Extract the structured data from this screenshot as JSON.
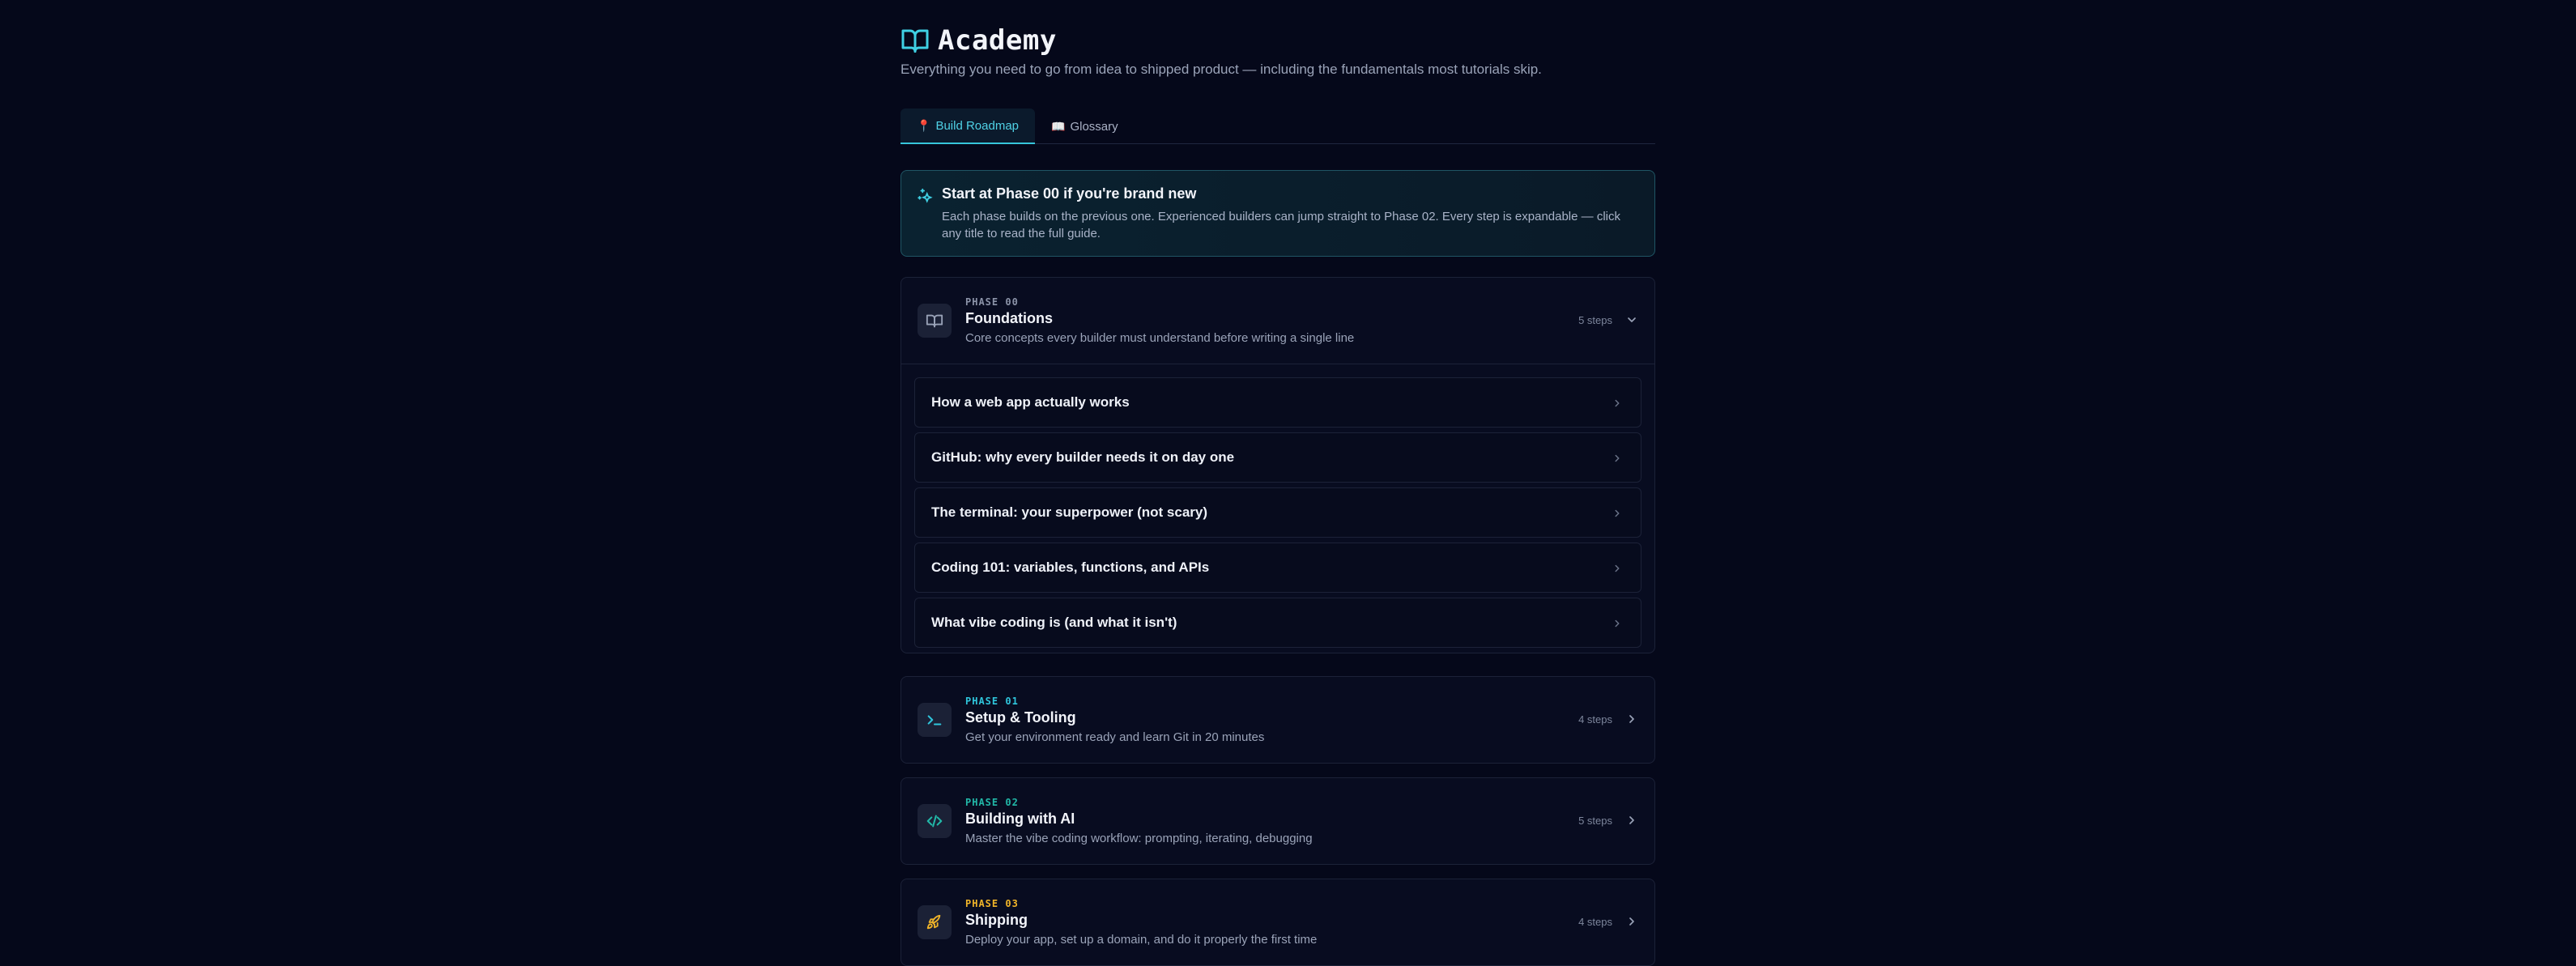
{
  "header": {
    "title": "Academy",
    "subtitle": "Everything you need to go from idea to shipped product — including the fundamentals most tutorials skip."
  },
  "tabs": [
    {
      "icon": "📍",
      "label": "Build Roadmap",
      "active": true
    },
    {
      "icon": "📖",
      "label": "Glossary",
      "active": false
    }
  ],
  "callout": {
    "title": "Start at Phase 00 if you're brand new",
    "body": "Each phase builds on the previous one. Experienced builders can jump straight to Phase 02. Every step is expandable — click any title to read the full guide."
  },
  "phases": [
    {
      "code": "PHASE 00",
      "title": "Foundations",
      "description": "Core concepts every builder must understand before writing a single line",
      "steps": "5 steps",
      "icon": "book-icon",
      "color": "#8b93a8",
      "expanded": true,
      "lessons": [
        "How a web app actually works",
        "GitHub: why every builder needs it on day one",
        "The terminal: your superpower (not scary)",
        "Coding 101: variables, functions, and APIs",
        "What vibe coding is (and what it isn't)"
      ]
    },
    {
      "code": "PHASE 01",
      "title": "Setup & Tooling",
      "description": "Get your environment ready and learn Git in 20 minutes",
      "steps": "4 steps",
      "icon": "terminal-icon",
      "color": "#2fc6dc",
      "expanded": false
    },
    {
      "code": "PHASE 02",
      "title": "Building with AI",
      "description": "Master the vibe coding workflow: prompting, iterating, debugging",
      "steps": "5 steps",
      "icon": "code-icon",
      "color": "#22b8a8",
      "expanded": false
    },
    {
      "code": "PHASE 03",
      "title": "Shipping",
      "description": "Deploy your app, set up a domain, and do it properly the first time",
      "steps": "4 steps",
      "icon": "rocket-icon",
      "color": "#f0b429",
      "expanded": false
    }
  ]
}
